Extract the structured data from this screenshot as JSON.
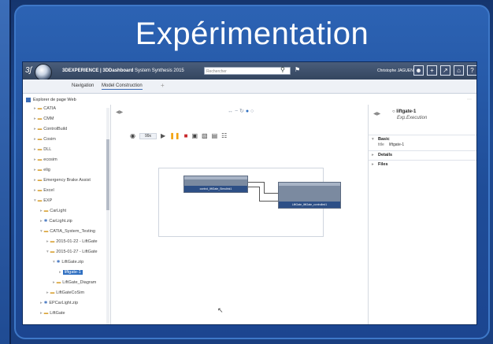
{
  "slide": {
    "title": "Expérimentation"
  },
  "app": {
    "brand_glyph": "3ʃ",
    "title_bold": "3DEXPERIENCE | 3DDashboard",
    "title_rest": " System Synthesis 2015",
    "search_placeholder": "Rechercher",
    "user_name": "Christophe JAGUEN",
    "tabs": [
      {
        "label": "Navigation"
      },
      {
        "label": "Model Construction"
      }
    ],
    "tab_add": "+",
    "widget_title": "Explorer de page Web"
  },
  "tree": {
    "items": [
      {
        "label": "CATIA",
        "type": "folder"
      },
      {
        "label": "CMM",
        "type": "folder"
      },
      {
        "label": "ControlBuild",
        "type": "folder"
      },
      {
        "label": "Cosim",
        "type": "folder"
      },
      {
        "label": "DLL",
        "type": "folder"
      },
      {
        "label": "ecosim",
        "type": "folder"
      },
      {
        "label": "elig",
        "type": "folder"
      },
      {
        "label": "Emergency Brake Assist",
        "type": "folder"
      },
      {
        "label": "Excel",
        "type": "folder"
      },
      {
        "label": "EXP",
        "type": "folder"
      },
      {
        "label": "CarLight",
        "type": "folder"
      },
      {
        "label": "CarLight.zip",
        "type": "sim"
      },
      {
        "label": "CATIA_System_Testing",
        "type": "folder"
      },
      {
        "label": "2015-01-22 - LiftGate",
        "type": "folder"
      },
      {
        "label": "2015-01-27 - LiftGate",
        "type": "folder"
      },
      {
        "label": "LiftGate.zip",
        "type": "sim"
      },
      {
        "label": "liftgate-1",
        "type": "sim",
        "selected": true
      },
      {
        "label": "LiftGate_Diagram",
        "type": "folder"
      },
      {
        "label": "LiftGateCoSim",
        "type": "folder"
      },
      {
        "label": "EPCarLight.zip",
        "type": "sim"
      },
      {
        "label": "LiftGate",
        "type": "folder"
      }
    ]
  },
  "center": {
    "speed_label": "99x",
    "block1_label": "control_liftGate_Simulink1",
    "block2_label": "LiftGate_liftGate_controlled1"
  },
  "props": {
    "title": "liftgate-1",
    "subtitle": "Exp.Execution",
    "sections": [
      {
        "label": "Basic"
      },
      {
        "label": "Details"
      },
      {
        "label": "Files"
      }
    ],
    "basic_rows": [
      {
        "key": "title",
        "value": "liftgate-1"
      }
    ]
  }
}
